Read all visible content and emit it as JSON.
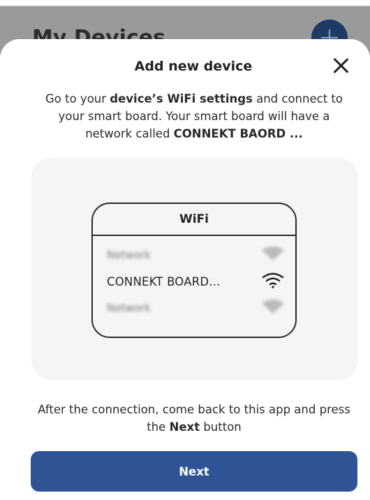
{
  "background": {
    "title": "My Devices",
    "add_icon": "plus-icon"
  },
  "sheet": {
    "title": "Add new device",
    "close_icon": "close-icon",
    "instructions": {
      "part1": "Go to your ",
      "bold1": "device’s WiFi settings",
      "part2": " and connect to your smart board. Your smart board will have a network called ",
      "bold2": "CONNEKT BAORD ..."
    },
    "illustration": {
      "header": "WiFi",
      "networks": [
        {
          "label": "Network",
          "blurred": true,
          "icon": "wifi-icon"
        },
        {
          "label": "CONNEKT BOARD...",
          "blurred": false,
          "icon": "wifi-icon"
        },
        {
          "label": "Network",
          "blurred": true,
          "icon": "wifi-icon"
        }
      ]
    },
    "after": {
      "part1": "After the connection, come back to this app and press the ",
      "bold": "Next",
      "part2": " button"
    },
    "next_label": "Next"
  },
  "colors": {
    "primary": "#2f5394",
    "card_bg": "#f4f5f7",
    "overlay": "#9a9a9a"
  }
}
